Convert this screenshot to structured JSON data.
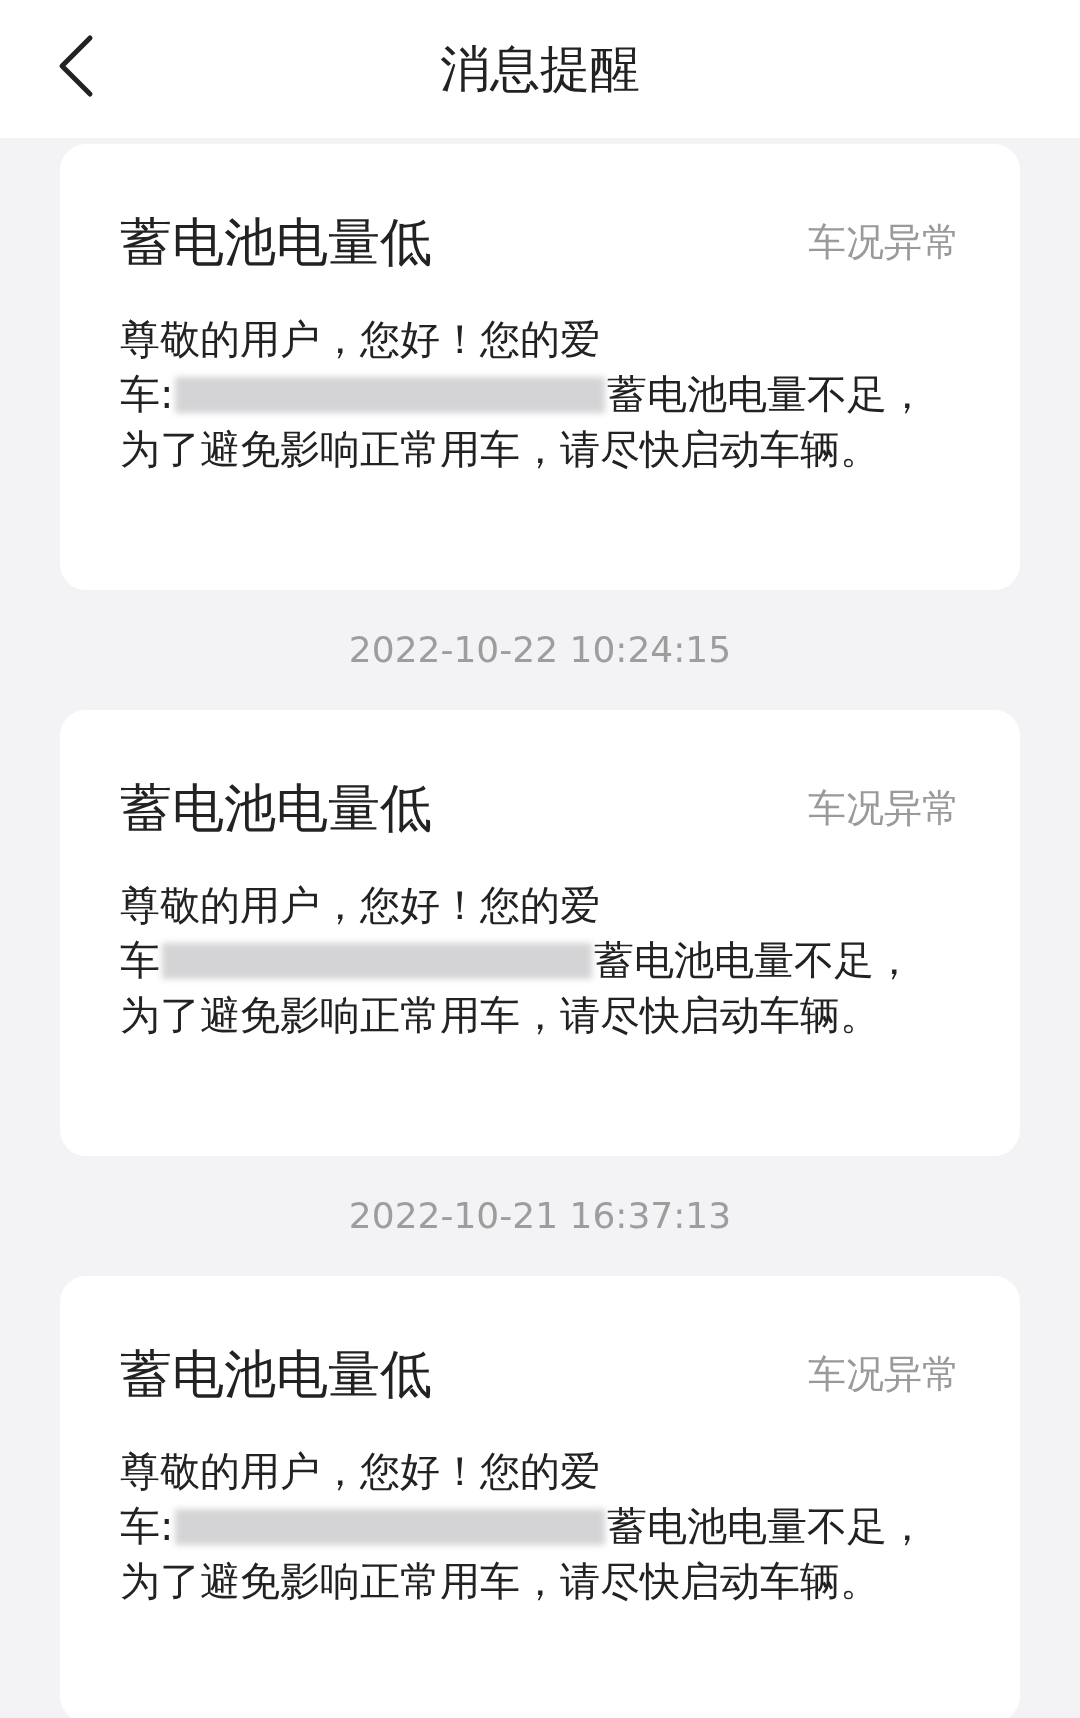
{
  "header": {
    "title": "消息提醒"
  },
  "feed": [
    {
      "kind": "card",
      "title": "蓄电池电量低",
      "tag": "车况异常",
      "line_1": "尊敬的用户，您好！您的爱",
      "line_2_start": "车:",
      "line_2_end": "蓄电池电量不足，",
      "line_3": "为了避免影响正常用车，请尽快启动车辆。"
    },
    {
      "kind": "timestamp",
      "text": "2022-10-22 10:24:15"
    },
    {
      "kind": "card",
      "title": "蓄电池电量低",
      "tag": "车况异常",
      "line_1": "尊敬的用户，您好！您的爱",
      "line_2_start": "车",
      "line_2_end": "蓄电池电量不足，",
      "line_3": "为了避免影响正常用车，请尽快启动车辆。"
    },
    {
      "kind": "timestamp",
      "text": "2022-10-21 16:37:13"
    },
    {
      "kind": "card",
      "title": "蓄电池电量低",
      "tag": "车况异常",
      "line_1": "尊敬的用户，您好！您的爱",
      "line_2_start": "车:",
      "line_2_end": "蓄电池电量不足，",
      "line_3": "为了避免影响正常用车，请尽快启动车辆。"
    }
  ]
}
